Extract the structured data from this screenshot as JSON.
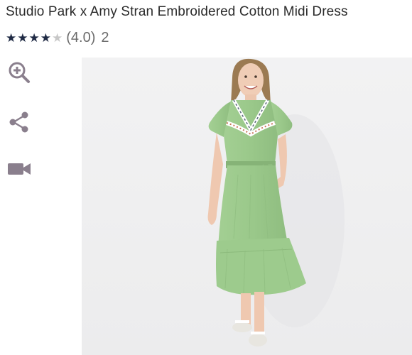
{
  "product": {
    "title": "Studio Park x Amy Stran Embroidered Cotton Midi Dress",
    "rating": 4,
    "max_rating": 5,
    "rating_text": "(4.0)",
    "review_count": "2"
  },
  "icons": {
    "zoom": "zoom-in-icon",
    "share": "share-icon",
    "video": "video-camera-icon"
  },
  "colors": {
    "star_filled": "#1f2a44",
    "star_empty": "#c7c7c7",
    "icon": "#8a7f8d",
    "dress": "#9cc98c"
  }
}
